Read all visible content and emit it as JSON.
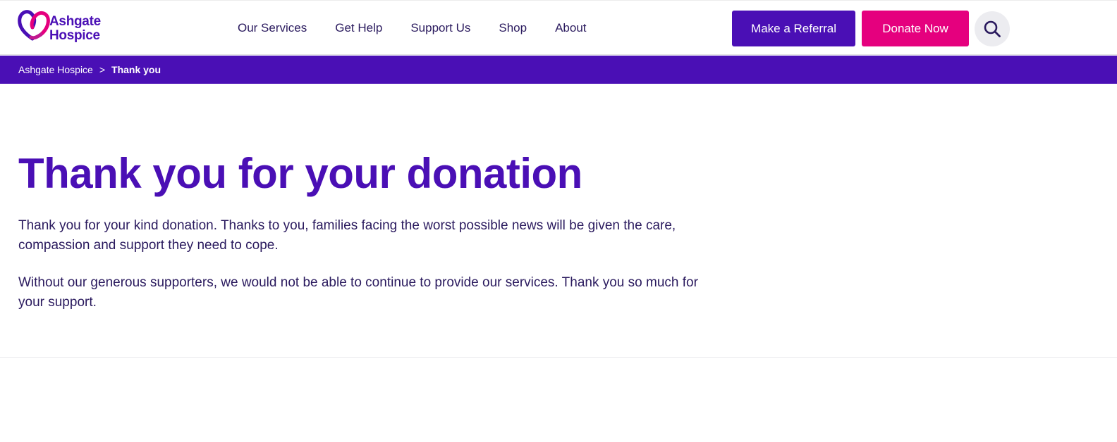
{
  "header": {
    "logo": {
      "line1": "Ashgate",
      "line2": "Hospice"
    },
    "nav": [
      {
        "label": "Our Services"
      },
      {
        "label": "Get Help"
      },
      {
        "label": "Support Us"
      },
      {
        "label": "Shop"
      },
      {
        "label": "About"
      }
    ],
    "referral_label": "Make a Referral",
    "donate_label": "Donate Now",
    "search_icon": "search-icon"
  },
  "breadcrumb": {
    "home": "Ashgate Hospice",
    "separator": ">",
    "current": "Thank you"
  },
  "main": {
    "title": "Thank you for your donation",
    "paragraphs": [
      "Thank you for your kind donation. Thanks to you, families facing the worst possible news will be given the care, compassion and support they need to cope.",
      "Without our generous supporters, we would not be able to continue to provide our services. Thank you so much for your support."
    ]
  },
  "colors": {
    "brand_purple": "#4a0fb5",
    "brand_pink": "#e5007e",
    "text_dark": "#2a1a5e"
  }
}
